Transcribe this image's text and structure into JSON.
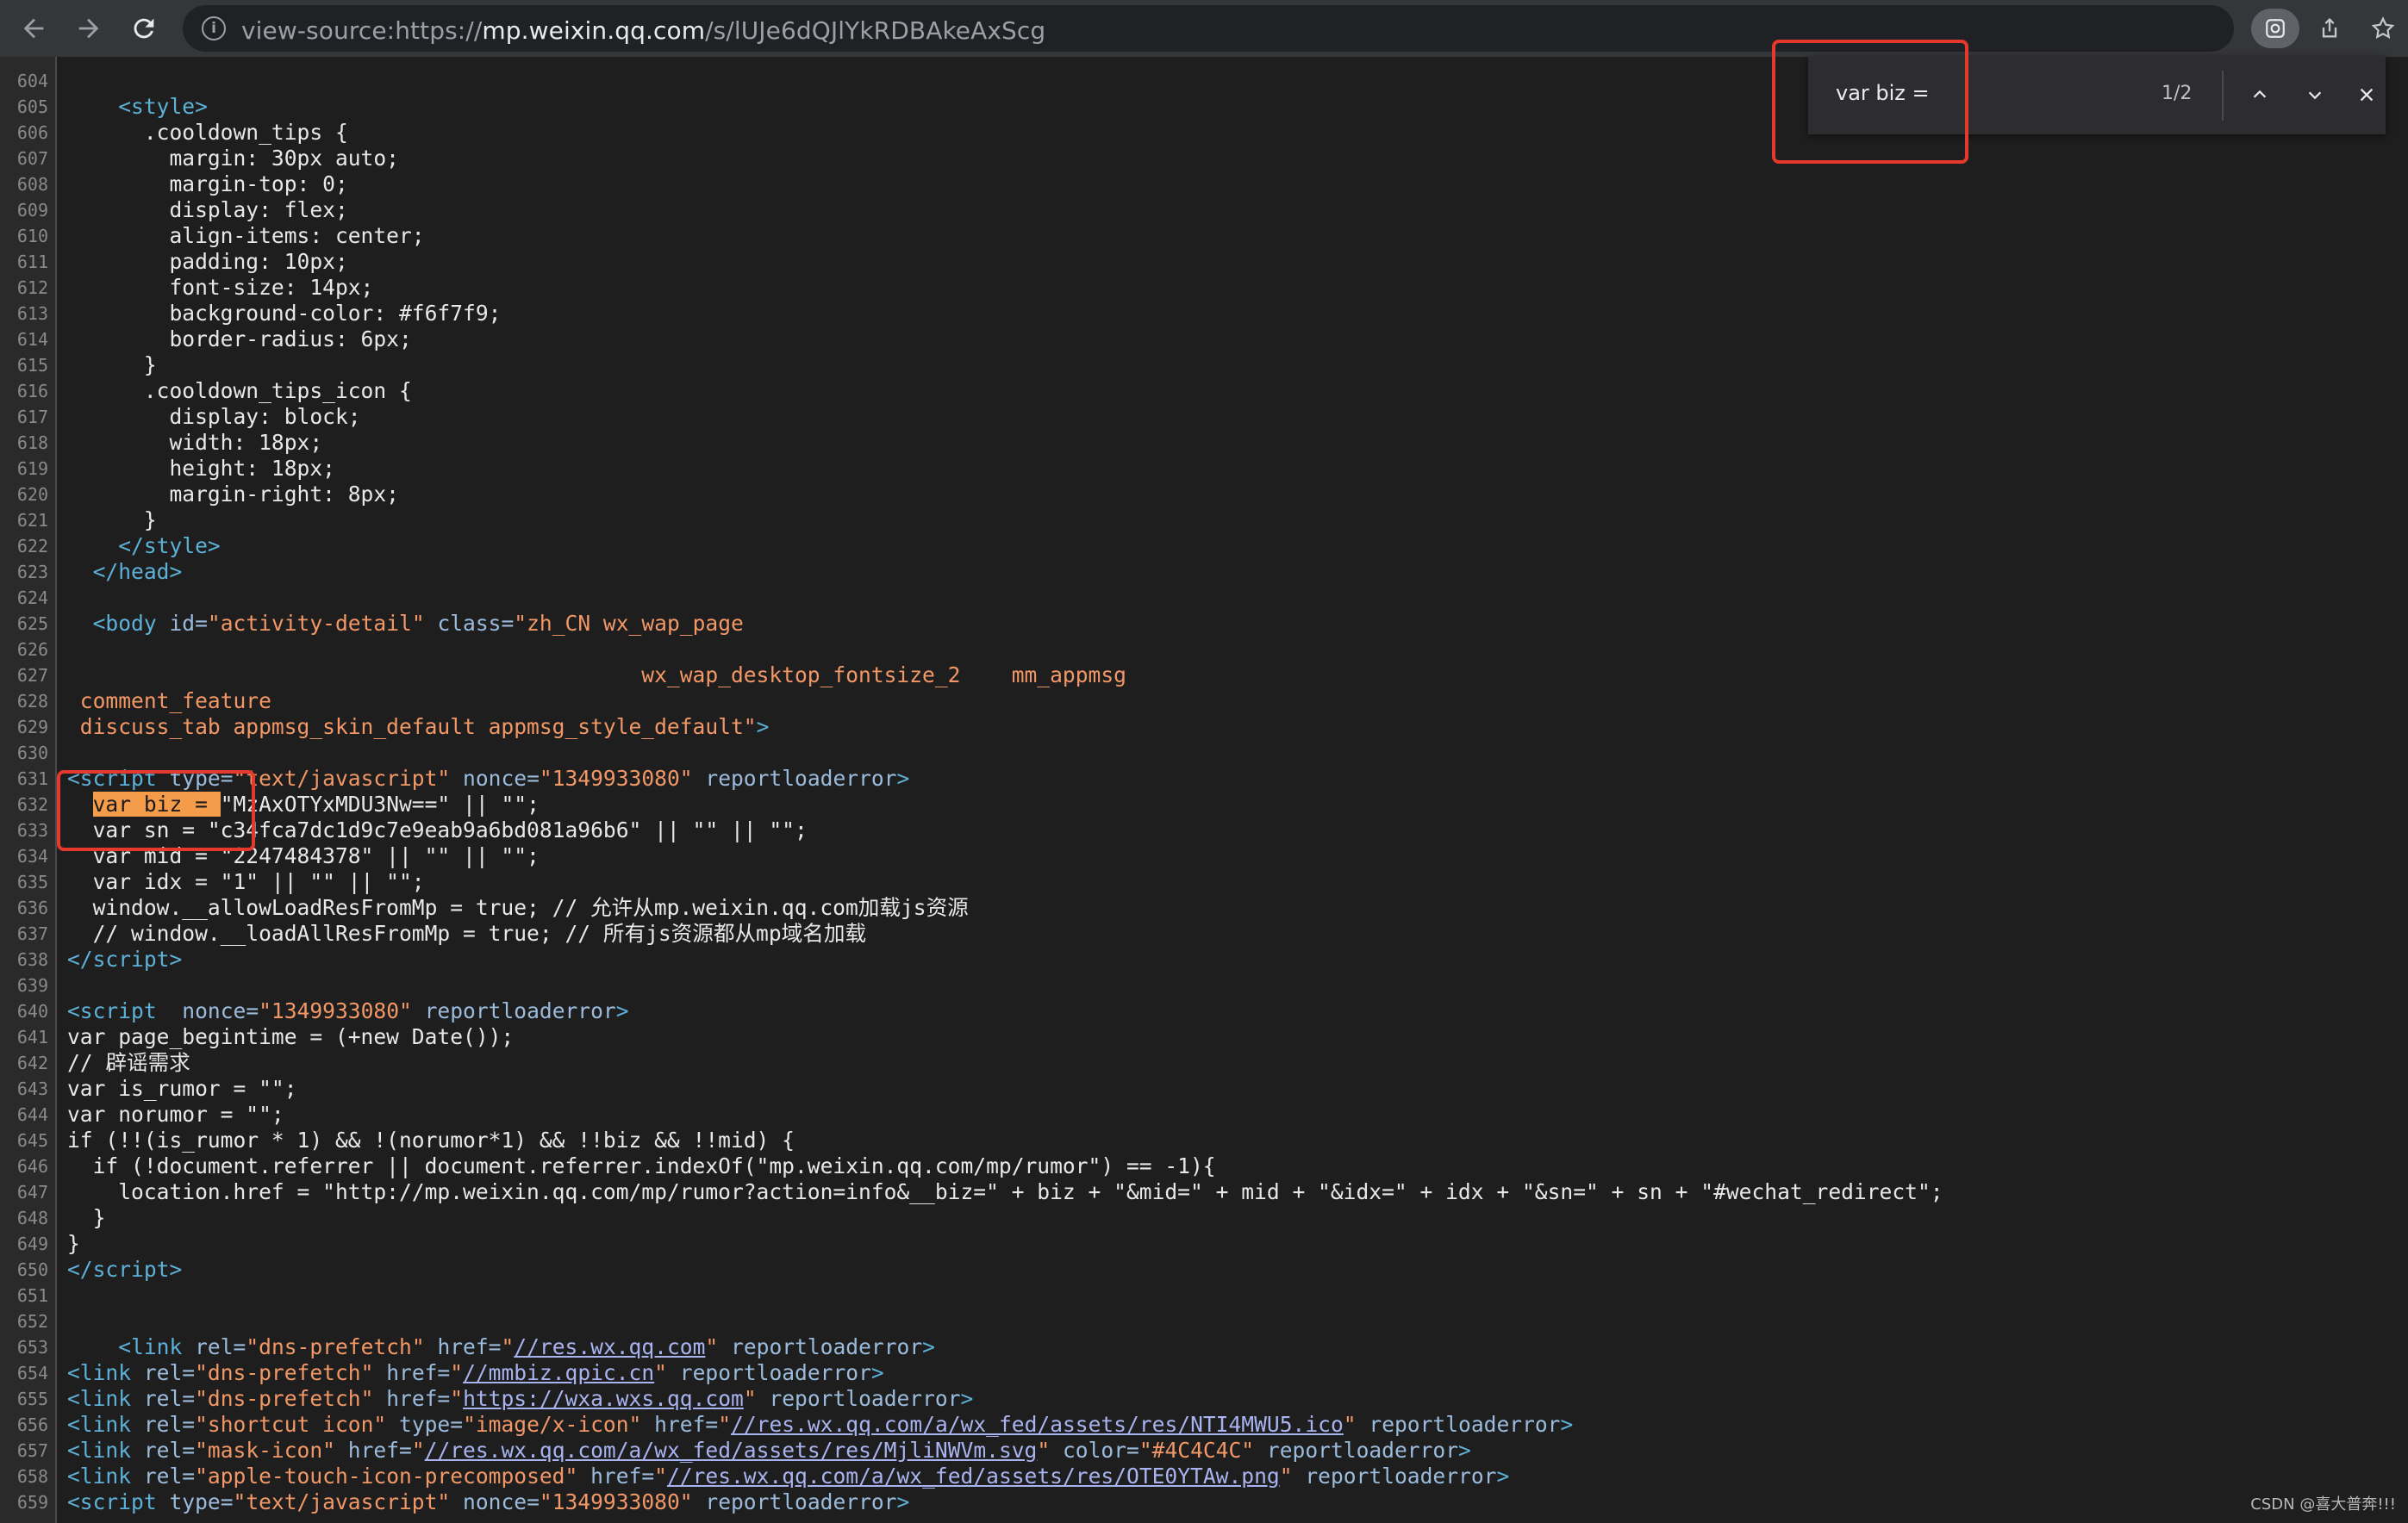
{
  "browser": {
    "url_prefix": "view-source:https://",
    "url_host": "mp.weixin.qq.com",
    "url_path": "/s/lUJe6dQJlYkRDBAkeAxScg",
    "icons": [
      "back-icon",
      "forward-icon",
      "reload-icon",
      "info-icon",
      "lens-icon",
      "share-icon",
      "star-icon"
    ]
  },
  "find": {
    "query": "var biz =",
    "count": "1/2"
  },
  "source": {
    "lines": [
      {
        "n": "604",
        "html": ""
      },
      {
        "n": "605",
        "html": "    <span class=\"tag\">&lt;style&gt;</span>"
      },
      {
        "n": "606",
        "html": "      .cooldown_tips {"
      },
      {
        "n": "607",
        "html": "        margin: 30px auto;"
      },
      {
        "n": "608",
        "html": "        margin-top: 0;"
      },
      {
        "n": "609",
        "html": "        display: flex;"
      },
      {
        "n": "610",
        "html": "        align-items: center;"
      },
      {
        "n": "611",
        "html": "        padding: 10px;"
      },
      {
        "n": "612",
        "html": "        font-size: 14px;"
      },
      {
        "n": "613",
        "html": "        background-color: #f6f7f9;"
      },
      {
        "n": "614",
        "html": "        border-radius: 6px;"
      },
      {
        "n": "615",
        "html": "      }"
      },
      {
        "n": "616",
        "html": "      .cooldown_tips_icon {"
      },
      {
        "n": "617",
        "html": "        display: block;"
      },
      {
        "n": "618",
        "html": "        width: 18px;"
      },
      {
        "n": "619",
        "html": "        height: 18px;"
      },
      {
        "n": "620",
        "html": "        margin-right: 8px;"
      },
      {
        "n": "621",
        "html": "      }"
      },
      {
        "n": "622",
        "html": "    <span class=\"tag\">&lt;/style&gt;</span>"
      },
      {
        "n": "623",
        "html": "  <span class=\"tag\">&lt;/head&gt;</span>"
      },
      {
        "n": "624",
        "html": ""
      },
      {
        "n": "625",
        "html": "  <span class=\"tag\">&lt;body</span> <span class=\"attr\">id=</span><span class=\"val\">\"activity-detail\"</span> <span class=\"attr\">class=</span><span class=\"val\">\"zh_CN wx_wap_page</span>"
      },
      {
        "n": "626",
        "html": ""
      },
      {
        "n": "627",
        "html": "<span class=\"val\">                                             wx_wap_desktop_fontsize_2    mm_appmsg</span>"
      },
      {
        "n": "628",
        "html": "<span class=\"val\"> comment_feature</span>"
      },
      {
        "n": "629",
        "html": "<span class=\"val\"> discuss_tab appmsg_skin_default appmsg_style_default\"</span><span class=\"tag\">&gt;</span>"
      },
      {
        "n": "630",
        "html": ""
      },
      {
        "n": "631",
        "html": "<span class=\"tag\">&lt;script</span> <span class=\"attr\">type=</span><span class=\"val\">\"text/javascript\"</span> <span class=\"attr\">nonce=</span><span class=\"val\">\"1349933080\"</span> <span class=\"attr\">reportloaderror</span><span class=\"tag\">&gt;</span>"
      },
      {
        "n": "632",
        "html": "  <span class=\"hl\">var biz = </span>\"MzAxOTYxMDU3Nw==\" || \"\";"
      },
      {
        "n": "633",
        "html": "  var sn = \"c34fca7dc1d9c7e9eab9a6bd081a96b6\" || \"\" || \"\";"
      },
      {
        "n": "634",
        "html": "  var mid = \"2247484378\" || \"\" || \"\";"
      },
      {
        "n": "635",
        "html": "  var idx = \"1\" || \"\" || \"\";"
      },
      {
        "n": "636",
        "html": "  window.__allowLoadResFromMp = true; // 允许从mp.weixin.qq.com加载js资源"
      },
      {
        "n": "637",
        "html": "  // window.__loadAllResFromMp = true; // 所有js资源都从mp域名加载"
      },
      {
        "n": "638",
        "html": "<span class=\"tag\">&lt;/script&gt;</span>"
      },
      {
        "n": "639",
        "html": ""
      },
      {
        "n": "640",
        "html": "<span class=\"tag\">&lt;script</span>  <span class=\"attr\">nonce=</span><span class=\"val\">\"1349933080\"</span> <span class=\"attr\">reportloaderror</span><span class=\"tag\">&gt;</span>"
      },
      {
        "n": "641",
        "html": "var page_begintime = (+new Date());"
      },
      {
        "n": "642",
        "html": "// 辟谣需求"
      },
      {
        "n": "643",
        "html": "var is_rumor = \"\";"
      },
      {
        "n": "644",
        "html": "var norumor = \"\";"
      },
      {
        "n": "645",
        "html": "if (!!(is_rumor * 1) &amp;&amp; !(norumor*1) &amp;&amp; !!biz &amp;&amp; !!mid) {"
      },
      {
        "n": "646",
        "html": "  if (!document.referrer || document.referrer.indexOf(\"mp.weixin.qq.com/mp/rumor\") == -1){"
      },
      {
        "n": "647",
        "html": "    location.href = \"http://mp.weixin.qq.com/mp/rumor?action=info&amp;__biz=\" + biz + \"&amp;mid=\" + mid + \"&amp;idx=\" + idx + \"&amp;sn=\" + sn + \"#wechat_redirect\";"
      },
      {
        "n": "648",
        "html": "  }"
      },
      {
        "n": "649",
        "html": "}"
      },
      {
        "n": "650",
        "html": "<span class=\"tag\">&lt;/script&gt;</span>"
      },
      {
        "n": "651",
        "html": ""
      },
      {
        "n": "652",
        "html": ""
      },
      {
        "n": "653",
        "html": "    <span class=\"tag\">&lt;link</span> <span class=\"attr\">rel=</span><span class=\"val\">\"dns-prefetch\"</span> <span class=\"attr\">href=</span><span class=\"val\">\"<span class=\"lnk\">//res.wx.qq.com</span>\"</span> <span class=\"attr\">reportloaderror</span><span class=\"tag\">&gt;</span>"
      },
      {
        "n": "654",
        "html": "<span class=\"tag\">&lt;link</span> <span class=\"attr\">rel=</span><span class=\"val\">\"dns-prefetch\"</span> <span class=\"attr\">href=</span><span class=\"val\">\"<span class=\"lnk\">//mmbiz.qpic.cn</span>\"</span> <span class=\"attr\">reportloaderror</span><span class=\"tag\">&gt;</span>"
      },
      {
        "n": "655",
        "html": "<span class=\"tag\">&lt;link</span> <span class=\"attr\">rel=</span><span class=\"val\">\"dns-prefetch\"</span> <span class=\"attr\">href=</span><span class=\"val\">\"<span class=\"lnk\">https://wxa.wxs.qq.com</span>\"</span> <span class=\"attr\">reportloaderror</span><span class=\"tag\">&gt;</span>"
      },
      {
        "n": "656",
        "html": "<span class=\"tag\">&lt;link</span> <span class=\"attr\">rel=</span><span class=\"val\">\"shortcut icon\"</span> <span class=\"attr\">type=</span><span class=\"val\">\"image/x-icon\"</span> <span class=\"attr\">href=</span><span class=\"val\">\"<span class=\"lnk\">//res.wx.qq.com/a/wx_fed/assets/res/NTI4MWU5.ico</span>\"</span> <span class=\"attr\">reportloaderror</span><span class=\"tag\">&gt;</span>"
      },
      {
        "n": "657",
        "html": "<span class=\"tag\">&lt;link</span> <span class=\"attr\">rel=</span><span class=\"val\">\"mask-icon\"</span> <span class=\"attr\">href=</span><span class=\"val\">\"<span class=\"lnk\">//res.wx.qq.com/a/wx_fed/assets/res/MjliNWVm.svg</span>\"</span> <span class=\"attr\">color=</span><span class=\"val\">\"#4C4C4C\"</span> <span class=\"attr\">reportloaderror</span><span class=\"tag\">&gt;</span>"
      },
      {
        "n": "658",
        "html": "<span class=\"tag\">&lt;link</span> <span class=\"attr\">rel=</span><span class=\"val\">\"apple-touch-icon-precomposed\"</span> <span class=\"attr\">href=</span><span class=\"val\">\"<span class=\"lnk\">//res.wx.qq.com/a/wx_fed/assets/res/OTE0YTAw.png</span>\"</span> <span class=\"attr\">reportloaderror</span><span class=\"tag\">&gt;</span>"
      },
      {
        "n": "659",
        "html": "<span class=\"tag\">&lt;script</span> <span class=\"attr\">type=</span><span class=\"val\">\"text/javascript\"</span> <span class=\"attr\">nonce=</span><span class=\"val\">\"1349933080\"</span> <span class=\"attr\">reportloaderror</span><span class=\"tag\">&gt;</span>"
      }
    ]
  },
  "watermark": "CSDN @喜大普奔!!!"
}
